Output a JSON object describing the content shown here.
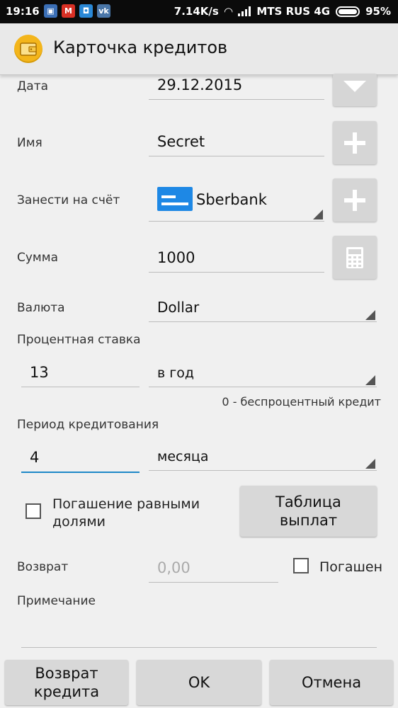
{
  "status_bar": {
    "time": "19:16",
    "net_speed": "7.14K/s",
    "carrier": "MTS RUS 4G",
    "battery": "95%"
  },
  "app_bar": {
    "title": "Карточка кредитов"
  },
  "form": {
    "date": {
      "label": "Дата",
      "value": "29.12.2015"
    },
    "name": {
      "label": "Имя",
      "value": "Secret"
    },
    "account": {
      "label": "Занести на счёт",
      "value": "Sberbank"
    },
    "amount": {
      "label": "Сумма",
      "value": "1000"
    },
    "currency": {
      "label": "Валюта",
      "value": "Dollar"
    },
    "interest": {
      "label": "Процентная ставка",
      "value": "13",
      "period": "в год",
      "hint": "0 - беспроцентный кредит"
    },
    "term": {
      "label": "Период кредитования",
      "value": "4",
      "unit": "месяца"
    },
    "equal_parts": {
      "label_line1": "Погашение равными",
      "label_line2": "долями",
      "checked": false
    },
    "schedule_button": {
      "line1": "Таблица",
      "line2": "выплат"
    },
    "returned": {
      "label": "Возврат",
      "placeholder": "0,00"
    },
    "paid_off": {
      "label": "Погашен",
      "checked": false
    },
    "note": {
      "label": "Примечание",
      "value": ""
    }
  },
  "bottom_buttons": {
    "return_line1": "Возврат",
    "return_line2": "кредита",
    "ok": "OK",
    "cancel": "Отмена"
  },
  "colors": {
    "accent": "#1e88c7",
    "app_icon": "#f3b51b",
    "account_icon": "#1e88e5"
  }
}
